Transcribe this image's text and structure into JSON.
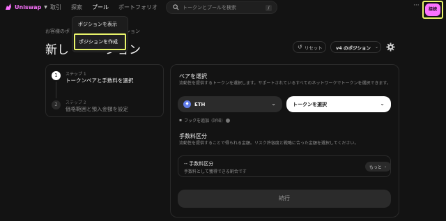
{
  "nav": {
    "brand": "Uniswap",
    "links": [
      "取引",
      "探索",
      "プール",
      "ポートフォリオ"
    ],
    "search_placeholder": "トークンとプールを検索",
    "search_shortcut": "/",
    "more": "···",
    "connect_label": "接続"
  },
  "dropdown": {
    "items": [
      "ポジションを表示",
      "ポジションを作成"
    ]
  },
  "header": {
    "breadcrumb_start": "お客様のポ",
    "breadcrumb_end": "ション",
    "title_start": "新し",
    "title_end": "ション",
    "reset_label": "リセット",
    "version_label": "v4 のポジション"
  },
  "steps": [
    {
      "number": "1",
      "label": "ステップ 1",
      "title": "トークンペアと手数料を選択"
    },
    {
      "number": "2",
      "label": "ステップ 2",
      "title": "価格範囲と預入金額を設定"
    }
  ],
  "main": {
    "pair_title": "ペアを選択",
    "pair_desc": "流動性を提供するトークンを選択します。サポートされているすべてのネットワークでトークンを選択できます。",
    "token_a": "ETH",
    "token_b_placeholder": "トークンを選択",
    "hook_label": "フックを追加",
    "hook_detail": "(詳細)",
    "fee_title": "手数料区分",
    "fee_desc": "流動性を提供することで得られる金額。リスク許容度と戦略に合った金額を選択してください。",
    "fee_box_title": "-- 手数料区分",
    "fee_box_sub": "手数料として獲得できる割合です",
    "more_label": "もっと",
    "continue_label": "続行"
  },
  "colors": {
    "accent": "#fc72ff",
    "highlight": "#e8f36a",
    "eth": "#627eea"
  }
}
